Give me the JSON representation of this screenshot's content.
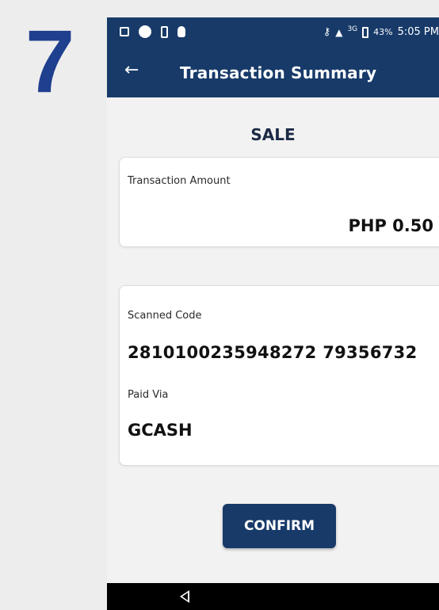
{
  "step_number": "7",
  "status_bar": {
    "signal": "3G",
    "battery": "43%",
    "time": "5:05 PM",
    "icons": [
      "notification-icon",
      "circle-icon",
      "battery-saver-icon",
      "debug-icon",
      "key-icon",
      "signal-icon",
      "battery-icon"
    ]
  },
  "app_bar": {
    "title": "Transaction Summary",
    "back_icon": "arrow-left-icon"
  },
  "transaction": {
    "type": "SALE",
    "amount_label": "Transaction Amount",
    "amount_value": "PHP 0.50",
    "scanned_code_label": "Scanned Code",
    "scanned_code_value": "2810100235948272 79356732",
    "paid_via_label": "Paid Via",
    "paid_via_value": "GCASH"
  },
  "confirm_label": "CONFIRM",
  "colors": {
    "primary": "#173a69",
    "step_number": "#1f3f8f",
    "background": "#f2f2f2"
  }
}
